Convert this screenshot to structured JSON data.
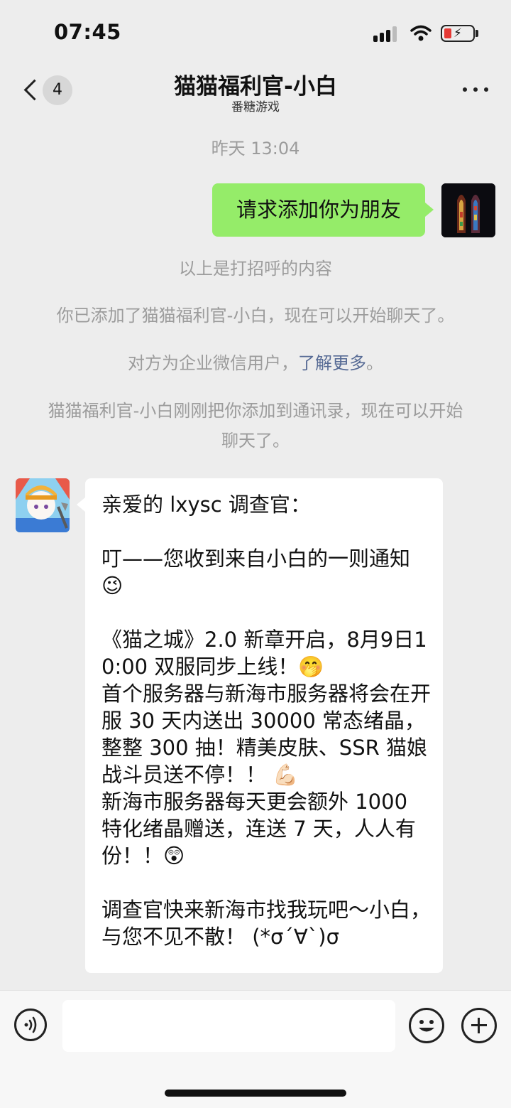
{
  "status_bar": {
    "time": "07:45"
  },
  "header": {
    "unread_count": "4",
    "title": "猫猫福利官-小白",
    "subtitle": "番糖游戏"
  },
  "chat": {
    "timestamp": "昨天 13:04",
    "outgoing_message": "请求添加你为朋友",
    "system_notes": {
      "greeting_above": "以上是打招呼的内容",
      "added_friend": "你已添加了猫猫福利官-小白，现在可以开始聊天了。",
      "enterprise_prefix": "对方为企业微信用户，",
      "enterprise_link": "了解更多",
      "enterprise_suffix": "。",
      "added_contacts": "猫猫福利官-小白刚刚把你添加到通讯录，现在可以开始聊天了。"
    },
    "incoming_message": "亲爱的 lxysc 调查官：\n\n叮——您收到来自小白的一则通知 😉\n\n《猫之城》2.0 新章开启，8月9日10:00 双服同步上线！🤭\n首个服务器与新海市服务器将会在开服 30 天内送出 30000 常态绪晶，整整 300 抽！精美皮肤、SSR 猫娘战斗员送不停！！ 💪🏻\n新海市服务器每天更会额外 1000 特化绪晶赠送，连送 7 天，人人有份！！😲\n\n调查官快来新海市找我玩吧～小白，与您不见不散！ (*σ´∀`)σ"
  },
  "input_bar": {
    "text_value": ""
  },
  "icons": {
    "back": "chevron-left-icon",
    "more": "more-dots-icon",
    "voice": "voice-icon",
    "emoji": "emoji-icon",
    "plus": "plus-icon"
  },
  "colors": {
    "outgoing_bubble": "#95ec69",
    "link": "#576b95",
    "background": "#ededed"
  }
}
